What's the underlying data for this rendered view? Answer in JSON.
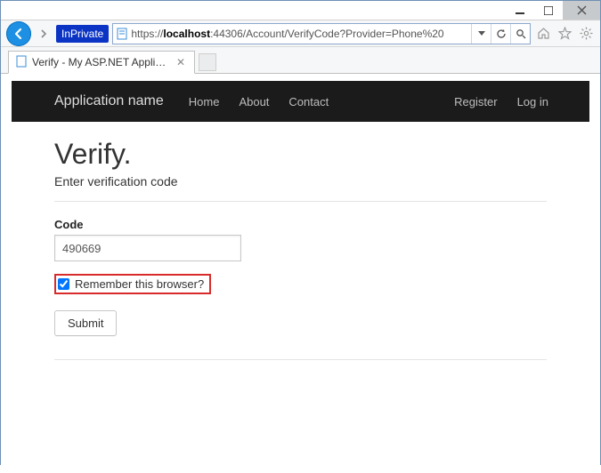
{
  "window": {
    "url_prefix": "https://",
    "url_host": "localhost",
    "url_rest": ":44306/Account/VerifyCode?Provider=Phone%20"
  },
  "inprivate_label": "InPrivate",
  "tab": {
    "title": "Verify - My ASP.NET Applic..."
  },
  "navbar": {
    "brand": "Application name",
    "links": {
      "home": "Home",
      "about": "About",
      "contact": "Contact"
    },
    "right": {
      "register": "Register",
      "login": "Log in"
    }
  },
  "page": {
    "title": "Verify.",
    "subtitle": "Enter verification code",
    "code_label": "Code",
    "code_value": "490669",
    "remember_label": "Remember this browser?",
    "remember_checked": true,
    "submit_label": "Submit"
  }
}
